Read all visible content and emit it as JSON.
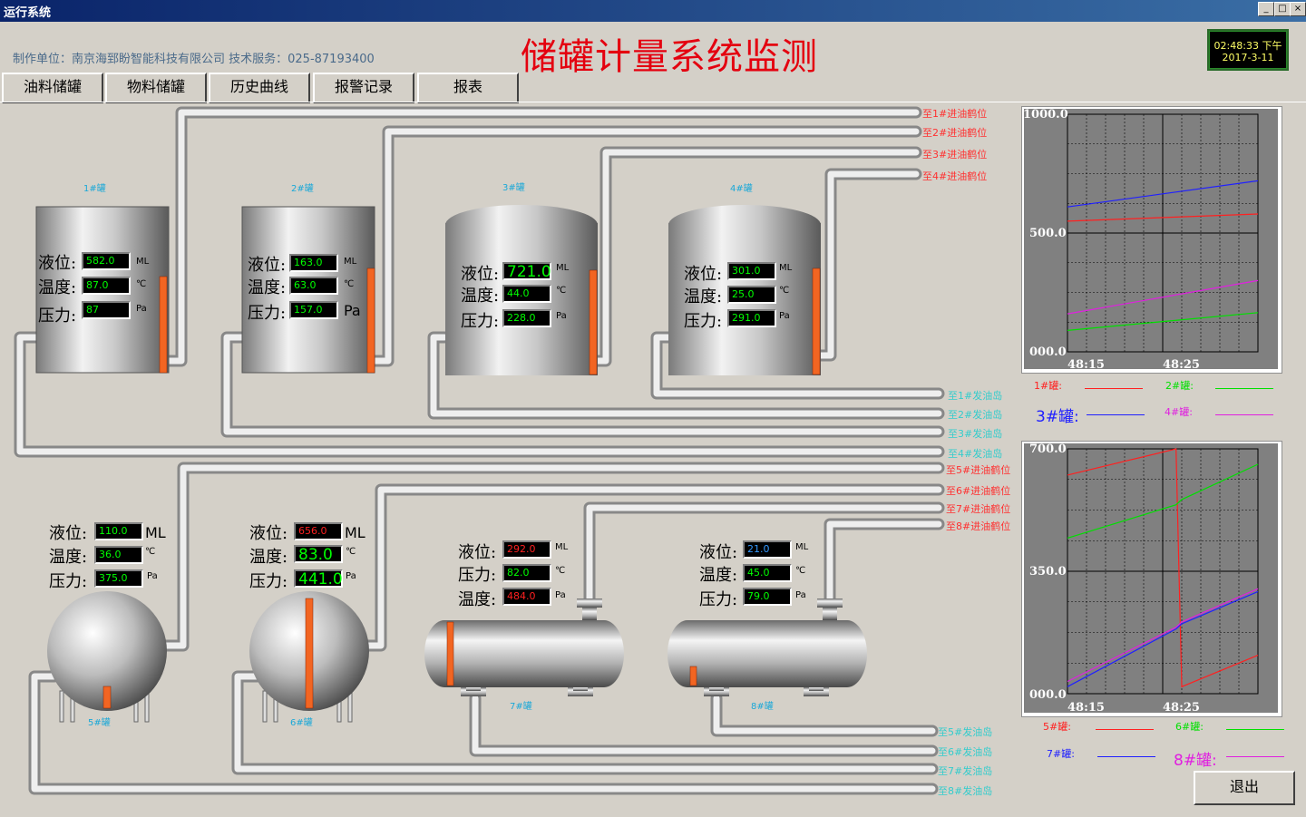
{
  "window": {
    "title": "运行系统"
  },
  "header": {
    "company": "制作单位：南京海郅盼智能科技有限公司   技术服务：025-87193400",
    "title": "储罐计量系统监测",
    "clock": {
      "time": "02:48:33 下午",
      "date": "2017-3-11"
    }
  },
  "nav": {
    "tabs": [
      "油料储罐",
      "物料储罐",
      "历史曲线",
      "报警记录",
      "报表"
    ]
  },
  "labels": {
    "level": "液位:",
    "temp": "温度:",
    "pressure": "压力:"
  },
  "tanks": [
    {
      "name": "1#罐",
      "level": "582.0",
      "temp": "87.0",
      "pressure": "87",
      "level_unit": "ML",
      "temp_unit": "℃",
      "pressure_unit": "Pa",
      "fill": 0.58
    },
    {
      "name": "2#罐",
      "level": "163.0",
      "temp": "63.0",
      "pressure": "157.0",
      "level_unit": "ML",
      "temp_unit": "℃",
      "pressure_unit": "Pa",
      "fill": 0.16
    },
    {
      "name": "3#罐",
      "level": "721.0",
      "temp": "44.0",
      "pressure": "228.0",
      "level_unit": "ML",
      "temp_unit": "℃",
      "pressure_unit": "Pa",
      "fill": 0.72
    },
    {
      "name": "4#罐",
      "level": "301.0",
      "temp": "25.0",
      "pressure": "291.0",
      "level_unit": "ML",
      "temp_unit": "℃",
      "pressure_unit": "Pa",
      "fill": 0.3
    },
    {
      "name": "5#罐",
      "level": "110.0",
      "temp": "36.0",
      "pressure": "375.0",
      "level_unit": "ML",
      "temp_unit": "℃",
      "pressure_unit": "Pa",
      "fill": 0.11
    },
    {
      "name": "6#罐",
      "level": "656.0",
      "temp": "83.0",
      "pressure": "441.0",
      "level_unit": "ML",
      "temp_unit": "℃",
      "pressure_unit": "Pa",
      "fill": 0.66
    },
    {
      "name": "7#罐",
      "level": "292.0",
      "pressure": "82.0",
      "temp": "484.0",
      "level_unit": "ML",
      "pressure_unit": "℃",
      "temp_unit": "Pa",
      "fill": 0.29
    },
    {
      "name": "8#罐",
      "level": "21.0",
      "temp": "45.0",
      "pressure": "79.0",
      "level_unit": "ML",
      "temp_unit": "℃",
      "pressure_unit": "Pa",
      "fill": 0.02
    }
  ],
  "destinations": {
    "inlet": [
      "至1#进油鹤位",
      "至2#进油鹤位",
      "至3#进油鹤位",
      "至4#进油鹤位",
      "至5#进油鹤位",
      "至6#进油鹤位",
      "至7#进油鹤位",
      "至8#进油鹤位"
    ],
    "outlet": [
      "至1#发油岛",
      "至2#发油岛",
      "至3#发油岛",
      "至4#发油岛",
      "至5#发油岛",
      "至6#发油岛",
      "至7#发油岛",
      "至8#发油岛"
    ]
  },
  "colors": {
    "series1": "#ff2020",
    "series2": "#00e000",
    "series3": "#2020ff",
    "series4": "#e020e0"
  },
  "chart_data": [
    {
      "type": "line",
      "yticks": [
        "1000.0",
        "500.0",
        "000.0"
      ],
      "xticks": [
        "48:15",
        "48:25"
      ],
      "ylim": [
        0,
        1000
      ],
      "x": [
        0,
        1
      ],
      "grid": true,
      "series": [
        {
          "name": "1#罐:",
          "values": [
            550,
            580
          ],
          "color": "#ff2020"
        },
        {
          "name": "2#罐:",
          "values": [
            90,
            165
          ],
          "color": "#00e000"
        },
        {
          "name": "3#罐:",
          "values": [
            610,
            720
          ],
          "color": "#2020ff"
        },
        {
          "name": "4#罐:",
          "values": [
            160,
            300
          ],
          "color": "#e020e0"
        }
      ]
    },
    {
      "type": "line",
      "yticks": [
        "700.0",
        "350.0",
        "000.0"
      ],
      "xticks": [
        "48:15",
        "48:25"
      ],
      "ylim": [
        0,
        700
      ],
      "x": [
        0,
        0.57,
        0.6,
        1
      ],
      "grid": true,
      "series": [
        {
          "name": "5#罐:",
          "values": [
            625,
            700,
            20,
            110
          ],
          "color": "#ff2020"
        },
        {
          "name": "6#罐:",
          "values": [
            445,
            540,
            555,
            656
          ],
          "color": "#00e000"
        },
        {
          "name": "7#罐:",
          "values": [
            20,
            185,
            200,
            292
          ],
          "color": "#2020ff"
        },
        {
          "name": "8#罐:",
          "values": [
            35,
            190,
            205,
            300
          ],
          "color": "#e020e0"
        }
      ]
    }
  ],
  "exit": {
    "label": "退出"
  }
}
